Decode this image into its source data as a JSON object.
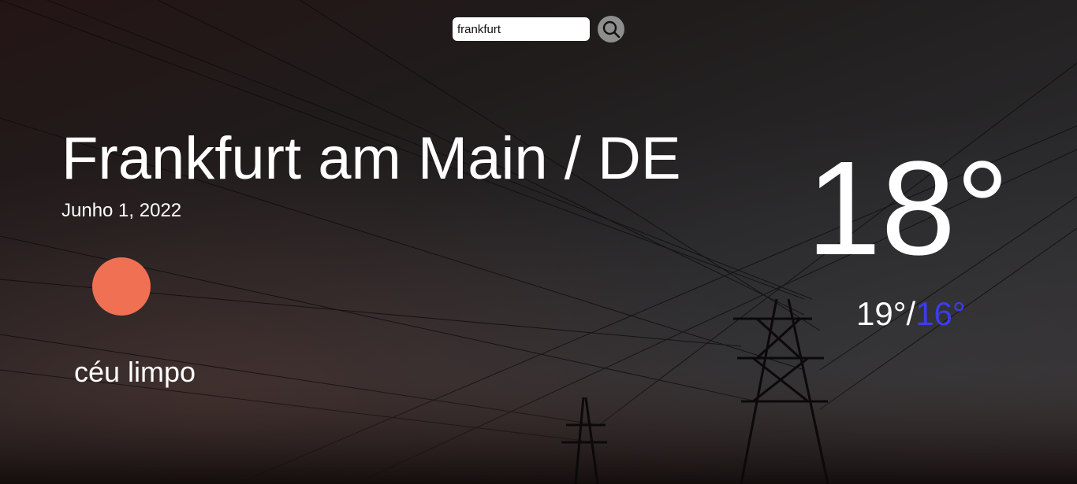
{
  "search": {
    "value": "frankfurt",
    "icon": "search-icon"
  },
  "weather": {
    "city": "Frankfurt am Main / DE",
    "date": "Junho 1, 2022",
    "icon": "sun-icon",
    "icon_color": "#ef7052",
    "description": "céu limpo",
    "temperature": "18°",
    "max": "19°",
    "separator": "/",
    "min": "16°",
    "min_color": "#3a3ee8"
  }
}
